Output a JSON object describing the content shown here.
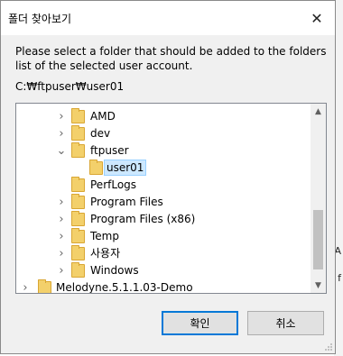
{
  "dialog": {
    "title": "폴더 찾아보기",
    "close_glyph": "✕",
    "instruction": "Please select a folder that should be added to the folders list of the selected user account.",
    "current_path": "C:₩ftpuser₩user01"
  },
  "tree": {
    "items": [
      {
        "label": "AMD",
        "expander": "›"
      },
      {
        "label": "dev",
        "expander": "›"
      },
      {
        "label": "ftpuser",
        "expander": "⌄"
      },
      {
        "label": "user01",
        "expander": ""
      },
      {
        "label": "PerfLogs",
        "expander": ""
      },
      {
        "label": "Program Files",
        "expander": "›"
      },
      {
        "label": "Program Files (x86)",
        "expander": "›"
      },
      {
        "label": "Temp",
        "expander": "›"
      },
      {
        "label": "사용자",
        "expander": "›"
      },
      {
        "label": "Windows",
        "expander": "›"
      },
      {
        "label": "Melodyne.5.1.1.03-Demo",
        "expander": "›"
      }
    ],
    "scroll_up": "▲",
    "scroll_down": "▼"
  },
  "buttons": {
    "ok_label": "확인",
    "cancel_label": "취소"
  },
  "background_fragments": [
    "A",
    "f"
  ]
}
